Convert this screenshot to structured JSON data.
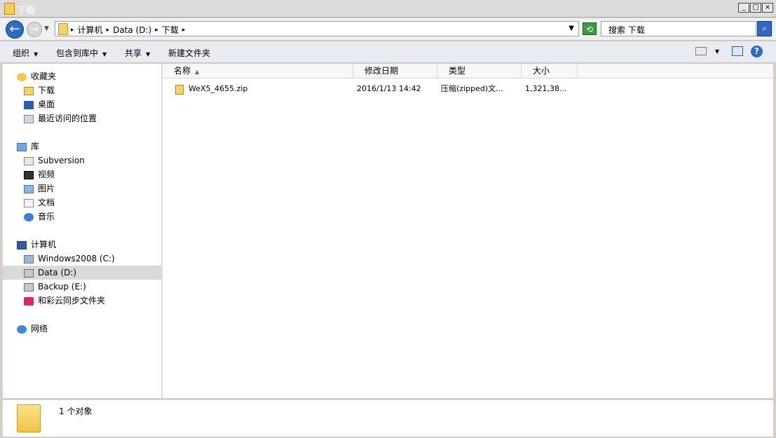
{
  "window": {
    "title": "下载"
  },
  "titlebar_buttons": {
    "minimize": "_",
    "maximize": "□",
    "close": "×"
  },
  "address": {
    "breadcrumbs": [
      "计算机",
      "Data (D:)",
      "下载"
    ],
    "search_placeholder": "搜索 下载"
  },
  "toolbar": {
    "organize": "组织",
    "include_library": "包含到库中",
    "share": "共享",
    "new_folder": "新建文件夹"
  },
  "nav": {
    "favorites": {
      "label": "收藏夹",
      "items": [
        "下载",
        "桌面",
        "最近访问的位置"
      ]
    },
    "libraries": {
      "label": "库",
      "items": [
        "Subversion",
        "视频",
        "图片",
        "文档",
        "音乐"
      ]
    },
    "computer": {
      "label": "计算机",
      "items": [
        "Windows2008 (C:)",
        "Data (D:)",
        "Backup (E:)",
        "和彩云同步文件夹"
      ]
    },
    "network": {
      "label": "网络"
    }
  },
  "columns": [
    "名称",
    "修改日期",
    "类型",
    "大小"
  ],
  "files": [
    {
      "name": "WeX5_4655.zip",
      "modified": "2016/1/13 14:42",
      "type": "压缩(zipped)文...",
      "size": "1,321,38..."
    }
  ],
  "status": {
    "count": "1 个对象"
  },
  "icons": {
    "back": "back-arrow-icon",
    "forward": "forward-arrow-icon",
    "search": "search-icon",
    "help": "help-icon"
  },
  "colors": {
    "accent": "#2f69c4",
    "folder": "#f5d36a"
  }
}
